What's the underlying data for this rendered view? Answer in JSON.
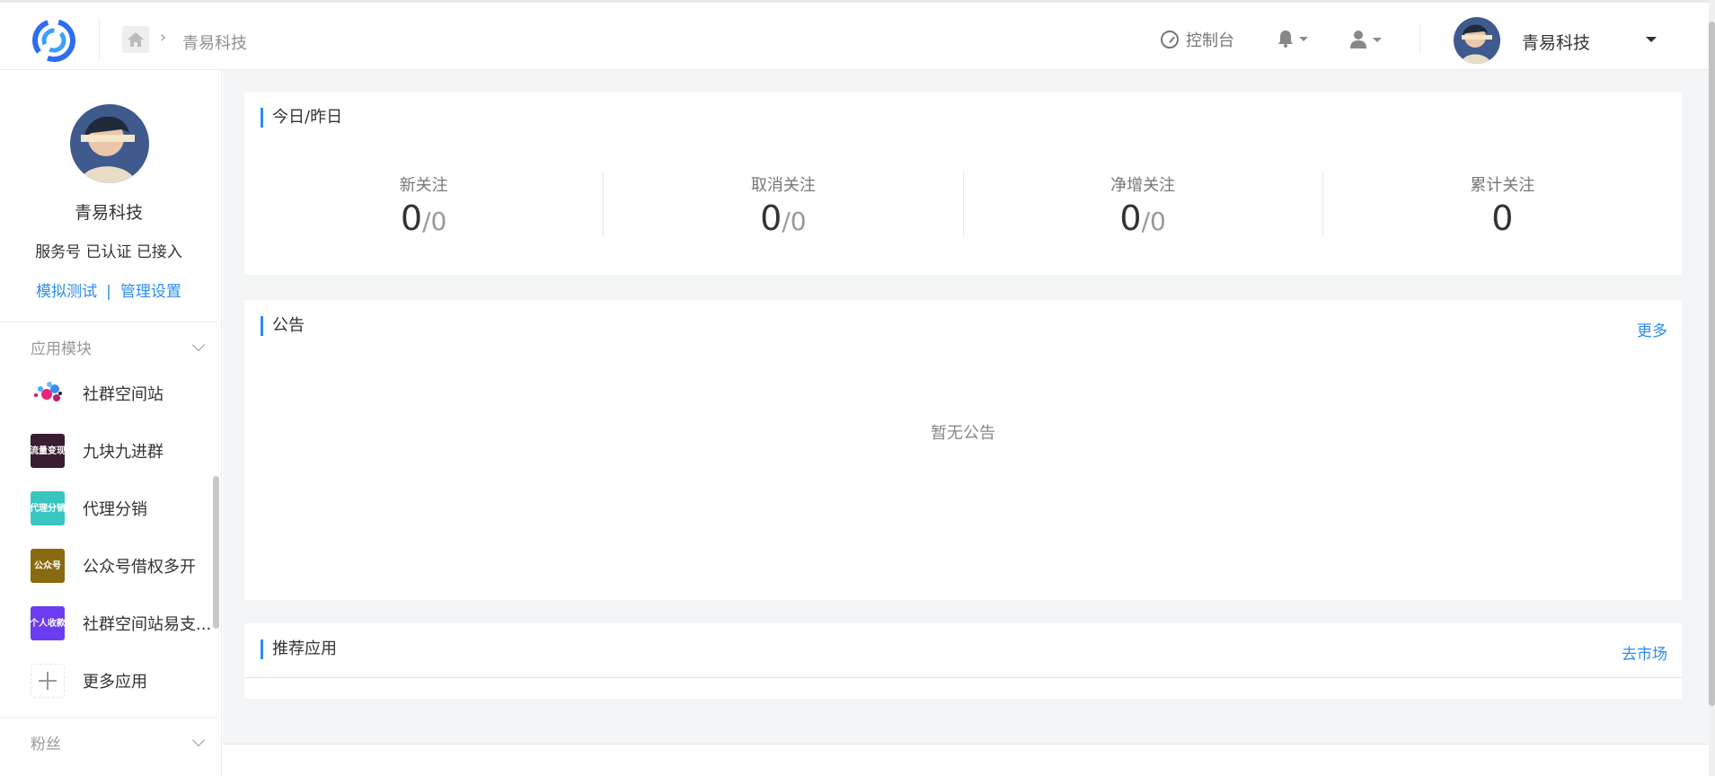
{
  "header": {
    "breadcrumb": "青易科技",
    "console_label": "控制台",
    "account_name": "青易科技"
  },
  "sidebar": {
    "name": "青易科技",
    "status": "服务号 已认证 已接入",
    "links": {
      "test": "模拟测试",
      "separator": "|",
      "settings": "管理设置"
    },
    "sections": {
      "apps": "应用模块",
      "fans": "粉丝"
    },
    "apps": [
      {
        "label": "社群空间站",
        "icon": "community-dots-icon",
        "color": "#ffffff"
      },
      {
        "label": "九块九进群",
        "icon": "traffic-monetize-icon",
        "color": "#3a1d2e",
        "icon_text": "流量变现"
      },
      {
        "label": "代理分销",
        "icon": "agent-distribution-icon",
        "color": "#39c6c0",
        "icon_text": "代理分销"
      },
      {
        "label": "公众号借权多开",
        "icon": "oa-borrow-icon",
        "color": "#8a6a10",
        "icon_text": "公众号"
      },
      {
        "label": "社群空间站易支...",
        "icon": "personal-pay-icon",
        "color": "#6b3cf0",
        "icon_text": "个人收款"
      },
      {
        "label": "更多应用",
        "icon": "plus-icon",
        "color": "#ffffff"
      }
    ]
  },
  "stats": {
    "title": "今日/昨日",
    "items": [
      {
        "label": "新关注",
        "today": "0",
        "yesterday": "0"
      },
      {
        "label": "取消关注",
        "today": "0",
        "yesterday": "0"
      },
      {
        "label": "净增关注",
        "today": "0",
        "yesterday": "0"
      },
      {
        "label": "累计关注",
        "today": "0"
      }
    ],
    "separator": "/"
  },
  "notice": {
    "title": "公告",
    "more": "更多",
    "empty": "暂无公告"
  },
  "recommend": {
    "title": "推荐应用",
    "more": "去市场"
  },
  "colors": {
    "accent": "#2d8cf0"
  }
}
